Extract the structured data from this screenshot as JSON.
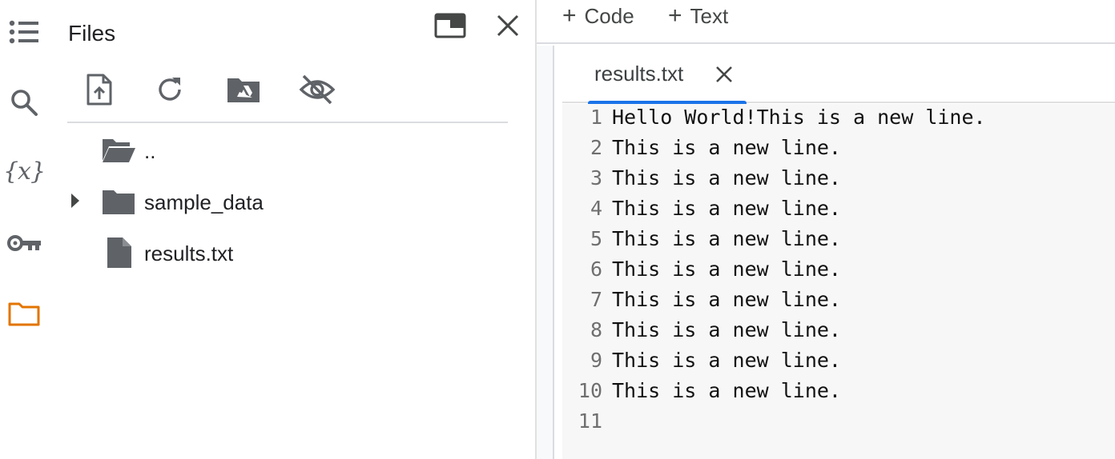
{
  "rail": {
    "items": [
      {
        "name": "table-of-contents",
        "icon": "list-icon"
      },
      {
        "name": "find",
        "icon": "search-icon"
      },
      {
        "name": "variables",
        "icon": "variables-icon",
        "glyph": "{x}"
      },
      {
        "name": "secrets",
        "icon": "key-icon"
      },
      {
        "name": "files",
        "icon": "folder-icon",
        "active": true
      }
    ],
    "active_color": "#e37400"
  },
  "files_panel": {
    "title": "Files",
    "toolbar": [
      "upload-file-icon",
      "refresh-icon",
      "mount-drive-icon",
      "hide-files-icon"
    ],
    "tree": [
      {
        "label": "..",
        "type": "parent-folder"
      },
      {
        "label": "sample_data",
        "type": "folder",
        "expandable": true
      },
      {
        "label": "results.txt",
        "type": "file"
      }
    ]
  },
  "toolbar": {
    "add_code": "Code",
    "add_text": "Text"
  },
  "editor": {
    "tab_label": "results.txt",
    "accent": "#1a73e8",
    "lines": [
      {
        "num": "1",
        "text": "Hello World!This is a new line."
      },
      {
        "num": "2",
        "text": "This is a new line."
      },
      {
        "num": "3",
        "text": "This is a new line."
      },
      {
        "num": "4",
        "text": "This is a new line."
      },
      {
        "num": "5",
        "text": "This is a new line."
      },
      {
        "num": "6",
        "text": "This is a new line."
      },
      {
        "num": "7",
        "text": "This is a new line."
      },
      {
        "num": "8",
        "text": "This is a new line."
      },
      {
        "num": "9",
        "text": "This is a new line."
      },
      {
        "num": "10",
        "text": "This is a new line."
      },
      {
        "num": "11",
        "text": ""
      }
    ]
  }
}
